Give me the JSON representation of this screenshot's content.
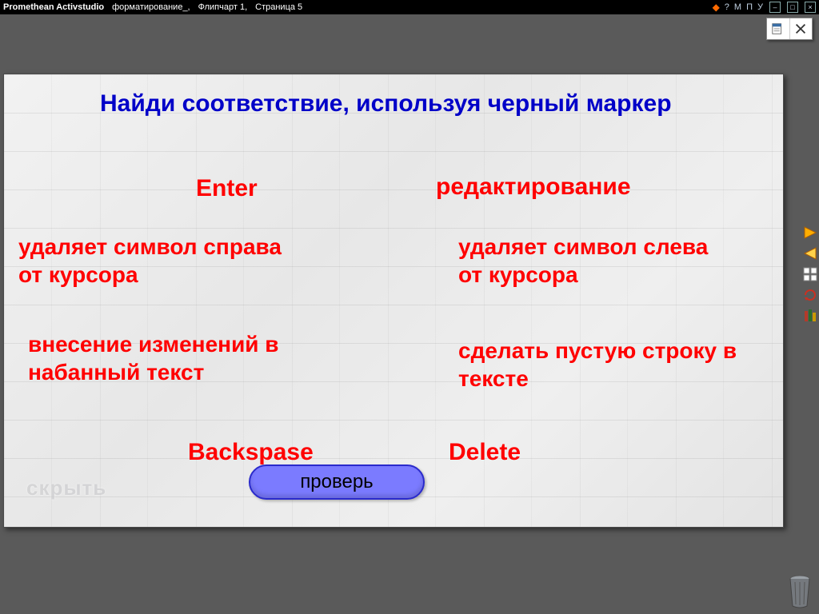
{
  "titlebar": {
    "app": "Promethean Activstudio",
    "file": "форматирование_,",
    "flip": "Флипчарт 1,",
    "page": "Страница 5",
    "sys": {
      "help": "?",
      "m": "М",
      "p": "П",
      "u": "У"
    }
  },
  "page": {
    "heading": "Найди соответствие, используя черный маркер",
    "items": {
      "enter": "Enter",
      "editing": "редактирование",
      "del_right": "удаляет символ справа от курсора",
      "del_left": "удаляет символ слева от курсора",
      "make_changes": "внесение изменений в набанный текст",
      "empty_line": "сделать пустую строку в тексте",
      "backspace": "Backspase",
      "delete": "Delete"
    },
    "hide_btn": "скрыть",
    "check_btn": "проверь"
  }
}
